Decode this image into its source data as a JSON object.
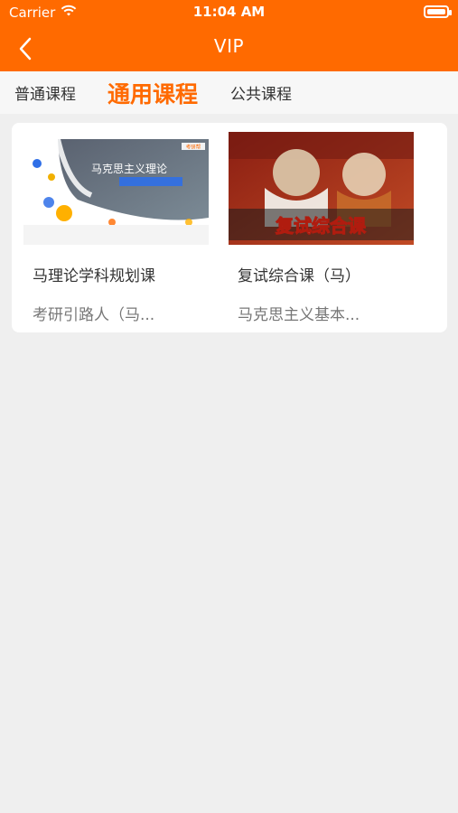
{
  "status_bar": {
    "carrier": "Carrier",
    "time": "11:04 AM"
  },
  "nav": {
    "title": "VIP"
  },
  "tabs": [
    {
      "label": "普通课程",
      "active": false
    },
    {
      "label": "通用课程",
      "active": true
    },
    {
      "label": "公共课程",
      "active": false
    }
  ],
  "courses": [
    {
      "title": "马理论学科规划课",
      "subtitle": "考研引路人（马...",
      "thumb_text": "马克思主义理论",
      "thumb_badge": "考研帮"
    },
    {
      "title": "复试综合课（马）",
      "subtitle": "马克思主义基本...",
      "thumb_text": "复试综合课"
    }
  ],
  "colors": {
    "accent": "#ff6a00",
    "background": "#efefef"
  }
}
